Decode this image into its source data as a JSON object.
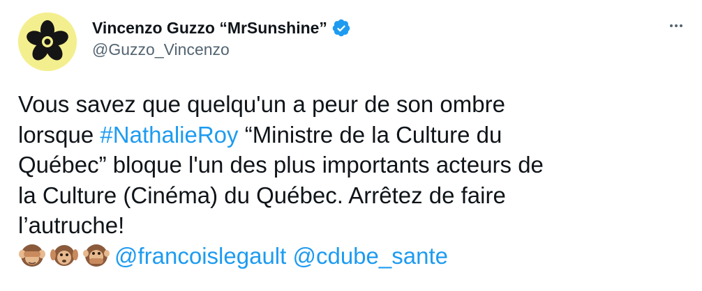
{
  "author": {
    "display_name": "Vincenzo Guzzo “MrSunshine”",
    "handle": "@Guzzo_Vincenzo",
    "verified": true
  },
  "tweet": {
    "line1": "Vous savez que quelqu'un a peur de son ombre",
    "line2_prefix": "lorsque ",
    "hashtag": "#NathalieRoy",
    "line2_suffix": " “Ministre de la Culture du",
    "line3": "Québec” bloque l'un des plus importants acteurs de",
    "line4": "la Culture (Cinéma) du Québec. Arrêtez de faire",
    "line5": "l’autruche!",
    "emojis": [
      "see-no-evil-monkey",
      "hear-no-evil-monkey",
      "speak-no-evil-monkey"
    ],
    "mention1": "@francoislegault",
    "mention2": "@cdube_sante"
  },
  "colors": {
    "link": "#1d9bf0",
    "text": "#0f1419",
    "secondary": "#536471",
    "avatar_bg": "#f4ef8e"
  },
  "icons": {
    "verified": "verified-badge-icon",
    "more": "more-horizontal-icon"
  }
}
